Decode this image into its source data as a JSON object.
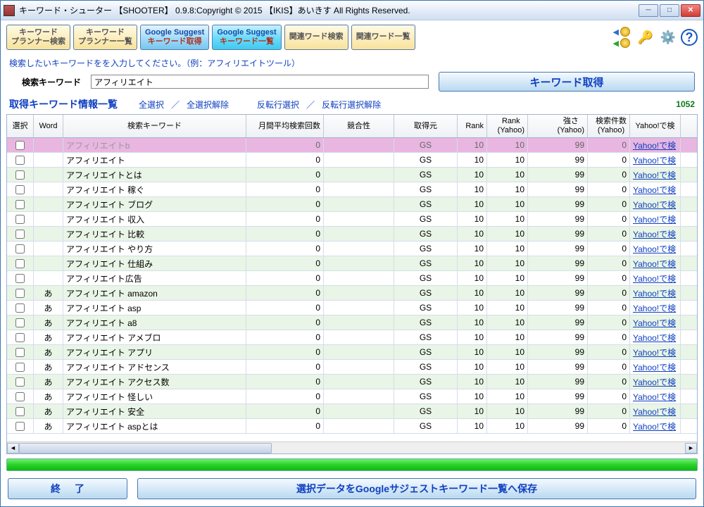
{
  "window": {
    "title": "キーワード・シューター 【SHOOTER】 0.9.8:Copyright © 2015 【IKIS】あいきす All Rights Reserved."
  },
  "toolbar": {
    "buttons": [
      {
        "l1": "キーワード",
        "l2": "プランナー検索",
        "cls": "yel"
      },
      {
        "l1": "キーワード",
        "l2": "プランナー一覧",
        "cls": "yel"
      },
      {
        "l1": "Google Suggest",
        "l2": "キーワード取得",
        "cls": "blue"
      },
      {
        "l1": "Google Suggest",
        "l2": "キーワード一覧",
        "cls": "cyan"
      },
      {
        "l1": "関連ワード検索",
        "l2": "",
        "cls": "yel"
      },
      {
        "l1": "関連ワード一覧",
        "l2": "",
        "cls": "yel"
      }
    ],
    "icons": [
      "coins-icon",
      "keys-icon",
      "gear-icon",
      "help-icon"
    ]
  },
  "instruction": "検索したいキーワードをを入力してください。（例：アフィリエイトツール）",
  "search": {
    "label": "検索キーワード",
    "value": "アフィリエイト",
    "button": "キーワード取得"
  },
  "listheader": {
    "title": "取得キーワード情報一覧",
    "links": [
      "全選択",
      "全選択解除",
      "反転行選択",
      "反転行選択解除"
    ],
    "count": "1052"
  },
  "columns": [
    "選択",
    "Word",
    "検索キーワード",
    "月間平均検索回数",
    "競合性",
    "取得元",
    "Rank",
    "Rank\n(Yahoo)",
    "強さ\n(Yahoo)",
    "検索件数\n(Yahoo)",
    "Yahoo!で検"
  ],
  "rows": [
    {
      "sel": true,
      "word": "",
      "kw": "アフィリエイトb",
      "m": "0",
      "c": "",
      "src": "GS",
      "r": "10",
      "ry": "10",
      "t": "99",
      "cnt": "0",
      "y": "Yahoo!で検"
    },
    {
      "sel": false,
      "word": "",
      "kw": "アフィリエイト",
      "m": "0",
      "c": "",
      "src": "GS",
      "r": "10",
      "ry": "10",
      "t": "99",
      "cnt": "0",
      "y": "Yahoo!で検"
    },
    {
      "sel": false,
      "word": "",
      "kw": "アフィリエイトとは",
      "m": "0",
      "c": "",
      "src": "GS",
      "r": "10",
      "ry": "10",
      "t": "99",
      "cnt": "0",
      "y": "Yahoo!で検"
    },
    {
      "sel": false,
      "word": "",
      "kw": "アフィリエイト 稼ぐ",
      "m": "0",
      "c": "",
      "src": "GS",
      "r": "10",
      "ry": "10",
      "t": "99",
      "cnt": "0",
      "y": "Yahoo!で検"
    },
    {
      "sel": false,
      "word": "",
      "kw": "アフィリエイト ブログ",
      "m": "0",
      "c": "",
      "src": "GS",
      "r": "10",
      "ry": "10",
      "t": "99",
      "cnt": "0",
      "y": "Yahoo!で検"
    },
    {
      "sel": false,
      "word": "",
      "kw": "アフィリエイト 収入",
      "m": "0",
      "c": "",
      "src": "GS",
      "r": "10",
      "ry": "10",
      "t": "99",
      "cnt": "0",
      "y": "Yahoo!で検"
    },
    {
      "sel": false,
      "word": "",
      "kw": "アフィリエイト 比較",
      "m": "0",
      "c": "",
      "src": "GS",
      "r": "10",
      "ry": "10",
      "t": "99",
      "cnt": "0",
      "y": "Yahoo!で検"
    },
    {
      "sel": false,
      "word": "",
      "kw": "アフィリエイト やり方",
      "m": "0",
      "c": "",
      "src": "GS",
      "r": "10",
      "ry": "10",
      "t": "99",
      "cnt": "0",
      "y": "Yahoo!で検"
    },
    {
      "sel": false,
      "word": "",
      "kw": "アフィリエイト 仕組み",
      "m": "0",
      "c": "",
      "src": "GS",
      "r": "10",
      "ry": "10",
      "t": "99",
      "cnt": "0",
      "y": "Yahoo!で検"
    },
    {
      "sel": false,
      "word": "",
      "kw": "アフィリエイト広告",
      "m": "0",
      "c": "",
      "src": "GS",
      "r": "10",
      "ry": "10",
      "t": "99",
      "cnt": "0",
      "y": "Yahoo!で検"
    },
    {
      "sel": false,
      "word": "あ",
      "kw": "アフィリエイト amazon",
      "m": "0",
      "c": "",
      "src": "GS",
      "r": "10",
      "ry": "10",
      "t": "99",
      "cnt": "0",
      "y": "Yahoo!で検"
    },
    {
      "sel": false,
      "word": "あ",
      "kw": "アフィリエイト asp",
      "m": "0",
      "c": "",
      "src": "GS",
      "r": "10",
      "ry": "10",
      "t": "99",
      "cnt": "0",
      "y": "Yahoo!で検"
    },
    {
      "sel": false,
      "word": "あ",
      "kw": "アフィリエイト a8",
      "m": "0",
      "c": "",
      "src": "GS",
      "r": "10",
      "ry": "10",
      "t": "99",
      "cnt": "0",
      "y": "Yahoo!で検"
    },
    {
      "sel": false,
      "word": "あ",
      "kw": "アフィリエイト アメブロ",
      "m": "0",
      "c": "",
      "src": "GS",
      "r": "10",
      "ry": "10",
      "t": "99",
      "cnt": "0",
      "y": "Yahoo!で検"
    },
    {
      "sel": false,
      "word": "あ",
      "kw": "アフィリエイト アプリ",
      "m": "0",
      "c": "",
      "src": "GS",
      "r": "10",
      "ry": "10",
      "t": "99",
      "cnt": "0",
      "y": "Yahoo!で検"
    },
    {
      "sel": false,
      "word": "あ",
      "kw": "アフィリエイト アドセンス",
      "m": "0",
      "c": "",
      "src": "GS",
      "r": "10",
      "ry": "10",
      "t": "99",
      "cnt": "0",
      "y": "Yahoo!で検"
    },
    {
      "sel": false,
      "word": "あ",
      "kw": "アフィリエイト アクセス数",
      "m": "0",
      "c": "",
      "src": "GS",
      "r": "10",
      "ry": "10",
      "t": "99",
      "cnt": "0",
      "y": "Yahoo!で検"
    },
    {
      "sel": false,
      "word": "あ",
      "kw": "アフィリエイト 怪しい",
      "m": "0",
      "c": "",
      "src": "GS",
      "r": "10",
      "ry": "10",
      "t": "99",
      "cnt": "0",
      "y": "Yahoo!で検"
    },
    {
      "sel": false,
      "word": "あ",
      "kw": "アフィリエイト 安全",
      "m": "0",
      "c": "",
      "src": "GS",
      "r": "10",
      "ry": "10",
      "t": "99",
      "cnt": "0",
      "y": "Yahoo!で検"
    },
    {
      "sel": false,
      "word": "あ",
      "kw": "アフィリエイト aspとは",
      "m": "0",
      "c": "",
      "src": "GS",
      "r": "10",
      "ry": "10",
      "t": "99",
      "cnt": "0",
      "y": "Yahoo!で検"
    }
  ],
  "footer": {
    "exit": "終了",
    "save": "選択データをGoogleサジェストキーワード一覧へ保存"
  }
}
